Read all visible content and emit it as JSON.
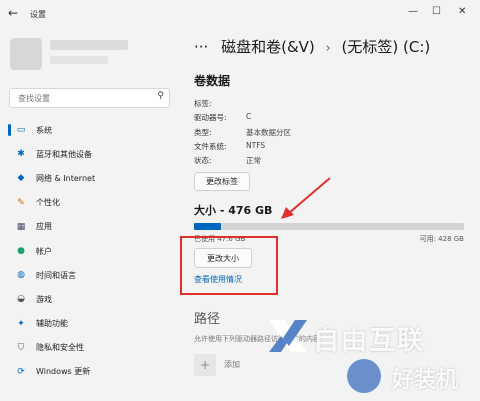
{
  "window": {
    "title": "设置",
    "back_glyph": "←",
    "minimize_glyph": "—",
    "maximize_glyph": "☐",
    "close_glyph": "✕"
  },
  "search": {
    "placeholder": "查找设置",
    "icon": "search-icon"
  },
  "sidebar": {
    "items": [
      {
        "label": "系统",
        "icon": "monitor-icon",
        "glyph": "▭",
        "color": "#0067c0",
        "active": true
      },
      {
        "label": "蓝牙和其他设备",
        "icon": "bluetooth-icon",
        "glyph": "✱",
        "color": "#0067c0"
      },
      {
        "label": "网络 & Internet",
        "icon": "wifi-icon",
        "glyph": "◆",
        "color": "#0067c0"
      },
      {
        "label": "个性化",
        "icon": "pen-icon",
        "glyph": "✎",
        "color": "#c56a1b"
      },
      {
        "label": "应用",
        "icon": "apps-icon",
        "glyph": "▦",
        "color": "#3d4a66"
      },
      {
        "label": "帐户",
        "icon": "account-icon",
        "glyph": "●",
        "color": "#1e9e6a"
      },
      {
        "label": "时间和语言",
        "icon": "globe-clock-icon",
        "glyph": "◍",
        "color": "#0067c0"
      },
      {
        "label": "游戏",
        "icon": "gamepad-icon",
        "glyph": "◒",
        "color": "#555555"
      },
      {
        "label": "辅助功能",
        "icon": "accessibility-icon",
        "glyph": "✦",
        "color": "#0067c0"
      },
      {
        "label": "隐私和安全性",
        "icon": "shield-icon",
        "glyph": "⛉",
        "color": "#666666"
      },
      {
        "label": "Windows 更新",
        "icon": "update-icon",
        "glyph": "⟳",
        "color": "#0067c0"
      }
    ]
  },
  "breadcrumb": {
    "dots": "···",
    "parent": "磁盘和卷(&V)",
    "separator": "›",
    "current": "(无标签) (C:)"
  },
  "volume": {
    "section_title": "卷数据",
    "properties": [
      {
        "label": "标签:",
        "value": ""
      },
      {
        "label": "驱动器号:",
        "value": "C"
      },
      {
        "label": "类型:",
        "value": "基本数据分区"
      },
      {
        "label": "文件系统:",
        "value": "NTFS"
      },
      {
        "label": "状态:",
        "value": "正常"
      }
    ],
    "change_label_button": "更改标签"
  },
  "size": {
    "title": "大小 - 476 GB",
    "used_fraction": 0.1,
    "used_text": "已使用 47.6 GB",
    "available_text": "可用: 428 GB",
    "change_size_button": "更改大小",
    "view_usage_link": "查看使用情况"
  },
  "path": {
    "title": "路径",
    "description": "允许使用下列驱动器路径访问此卷的内容",
    "add_glyph": "+",
    "add_label": "添加"
  },
  "colors": {
    "accent": "#0067c0",
    "highlight": "#e0302a"
  },
  "watermarks": {
    "primary": "自由互联",
    "secondary": "好装机"
  }
}
